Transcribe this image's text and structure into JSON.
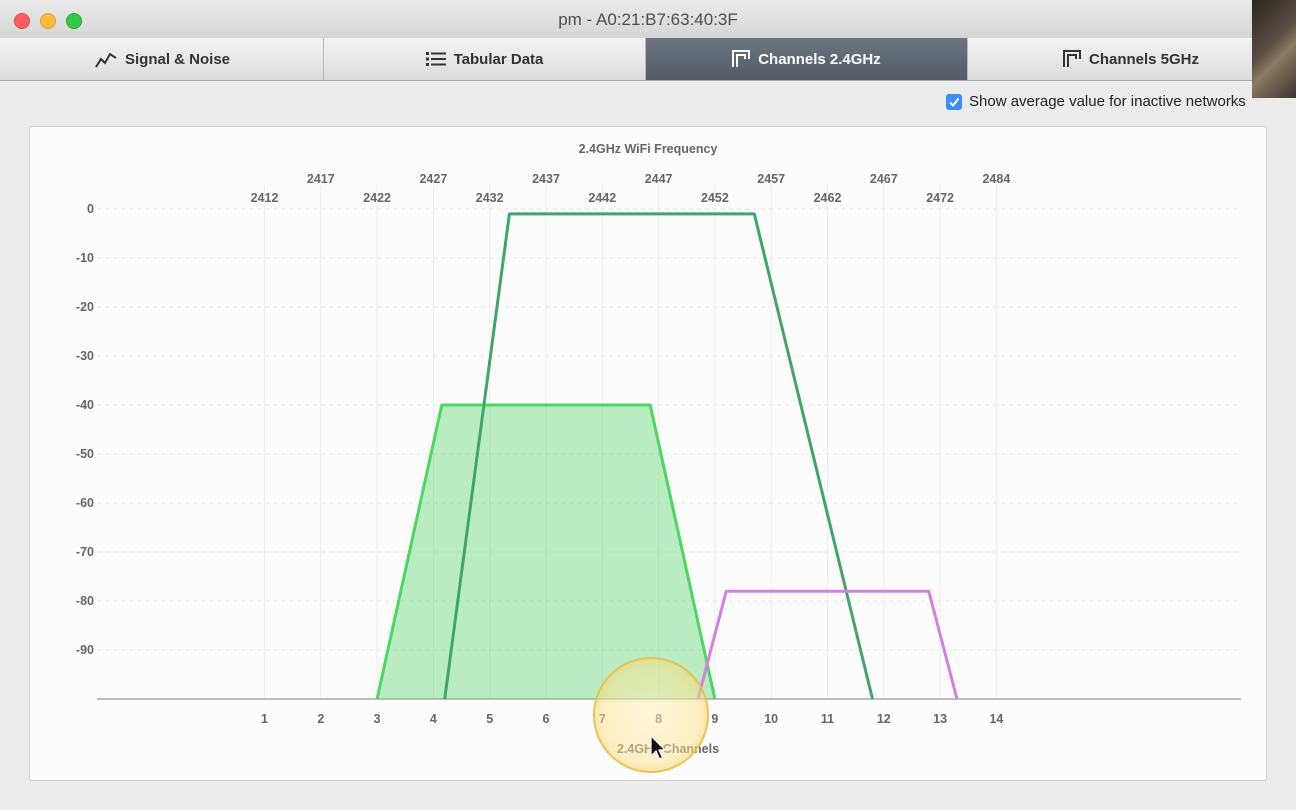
{
  "window": {
    "title": "pm - A0:21:B7:63:40:3F"
  },
  "tabs": [
    {
      "label": "Signal & Noise",
      "icon": "line-chart-icon",
      "active": false
    },
    {
      "label": "Tabular Data",
      "icon": "list-icon",
      "active": false
    },
    {
      "label": "Channels 2.4GHz",
      "icon": "channel-icon",
      "active": true
    },
    {
      "label": "Channels 5GHz",
      "icon": "channel-icon",
      "active": false
    }
  ],
  "options": {
    "show_average_label": "Show average value for inactive networks",
    "show_average_checked": true
  },
  "chart_data": {
    "type": "area",
    "title": "2.4GHz WiFi Frequency",
    "xlabel": "2.4GHz Channels",
    "ylabel": "",
    "grid": true,
    "xlim": [
      0,
      14.5
    ],
    "ylim": [
      -100,
      0
    ],
    "yticks": [
      0,
      -10,
      -20,
      -30,
      -40,
      -50,
      -60,
      -70,
      -80,
      -90
    ],
    "channels": [
      {
        "channel": "1",
        "freq": "2412"
      },
      {
        "channel": "2",
        "freq": "2417"
      },
      {
        "channel": "3",
        "freq": "2422"
      },
      {
        "channel": "4",
        "freq": "2427"
      },
      {
        "channel": "5",
        "freq": "2432"
      },
      {
        "channel": "6",
        "freq": "2437"
      },
      {
        "channel": "7",
        "freq": "2442"
      },
      {
        "channel": "8",
        "freq": "2447"
      },
      {
        "channel": "9",
        "freq": "2452"
      },
      {
        "channel": "10",
        "freq": "2457"
      },
      {
        "channel": "11",
        "freq": "2462"
      },
      {
        "channel": "12",
        "freq": "2467"
      },
      {
        "channel": "13",
        "freq": "2472"
      },
      {
        "channel": "14",
        "freq": "2484"
      }
    ],
    "series": [
      {
        "color": "#4cd662",
        "filled": true,
        "points": [
          [
            3.0,
            -100
          ],
          [
            4.15,
            -40
          ],
          [
            7.85,
            -40
          ],
          [
            9.0,
            -100
          ]
        ]
      },
      {
        "color": "#3ea66a",
        "filled": false,
        "points": [
          [
            4.2,
            -100
          ],
          [
            5.35,
            -1
          ],
          [
            9.7,
            -1
          ],
          [
            11.8,
            -100
          ]
        ]
      },
      {
        "color": "#d77ee6",
        "filled": false,
        "points": [
          [
            8.7,
            -100
          ],
          [
            9.2,
            -78
          ],
          [
            12.8,
            -78
          ],
          [
            13.3,
            -100
          ]
        ]
      }
    ]
  }
}
